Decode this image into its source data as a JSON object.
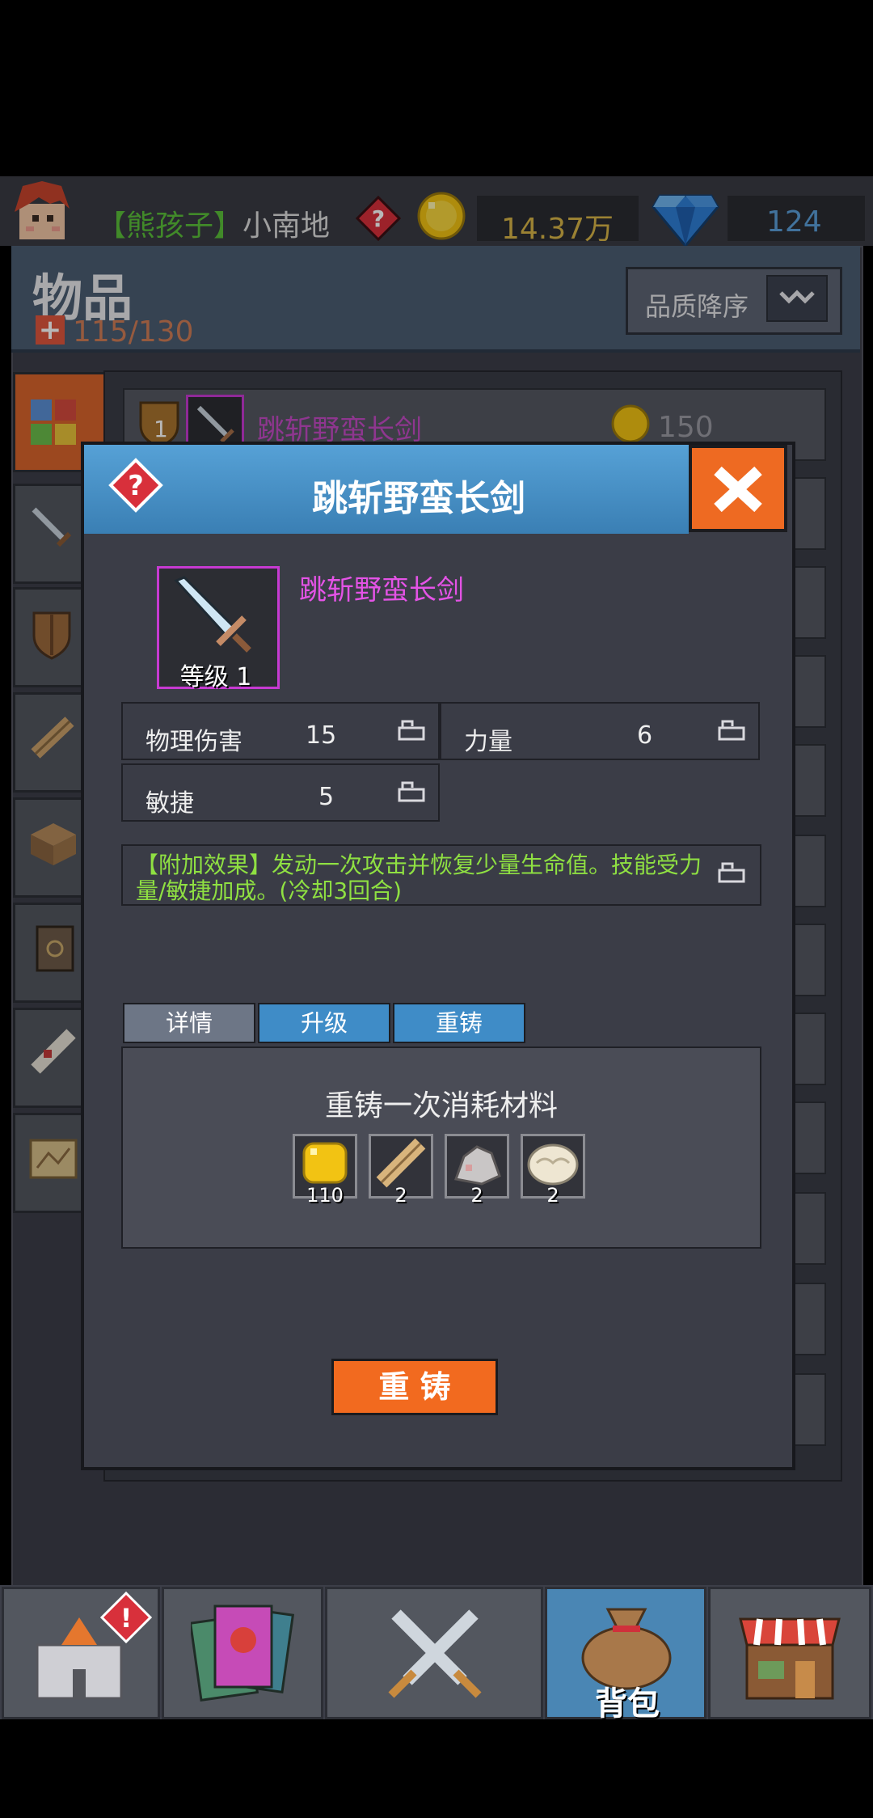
{
  "status": {
    "player_tag": "【熊孩子】",
    "player_name": "小南地",
    "gold": "14.37万",
    "gems": "124"
  },
  "inventory": {
    "title": "物品",
    "capacity": "115/130",
    "sort_label": "品质降序",
    "first_row": {
      "badge_level": "1",
      "name": "跳斩野蛮长剑",
      "price": "150"
    }
  },
  "modal": {
    "title": "跳斩野蛮长剑",
    "item_name": "跳斩野蛮长剑",
    "item_level": "等级 1",
    "stats": [
      {
        "label": "物理伤害",
        "value": "15"
      },
      {
        "label": "力量",
        "value": "6"
      },
      {
        "label": "敏捷",
        "value": "5"
      }
    ],
    "effect": "【附加效果】发动一次攻击并恢复少量生命值。技能受力量/敏捷加成。(冷却3回合)",
    "tabs": [
      "详情",
      "升级",
      "重铸"
    ],
    "active_tab": "重铸",
    "forge_title": "重铸一次消耗材料",
    "materials": [
      {
        "icon": "gold-coin-icon",
        "count": "110"
      },
      {
        "icon": "wood-log-icon",
        "count": "2"
      },
      {
        "icon": "stone-ore-icon",
        "count": "2"
      },
      {
        "icon": "wool-icon",
        "count": "2"
      }
    ],
    "reforge_button": "重 铸"
  },
  "bottom_nav": {
    "active_label": "背包"
  },
  "colors": {
    "accent_orange": "#f26a1f",
    "rarity_purple": "#e453e6",
    "effect_green": "#8fe042",
    "gold_text": "#d7b447",
    "gem_text": "#5b9fd9"
  }
}
